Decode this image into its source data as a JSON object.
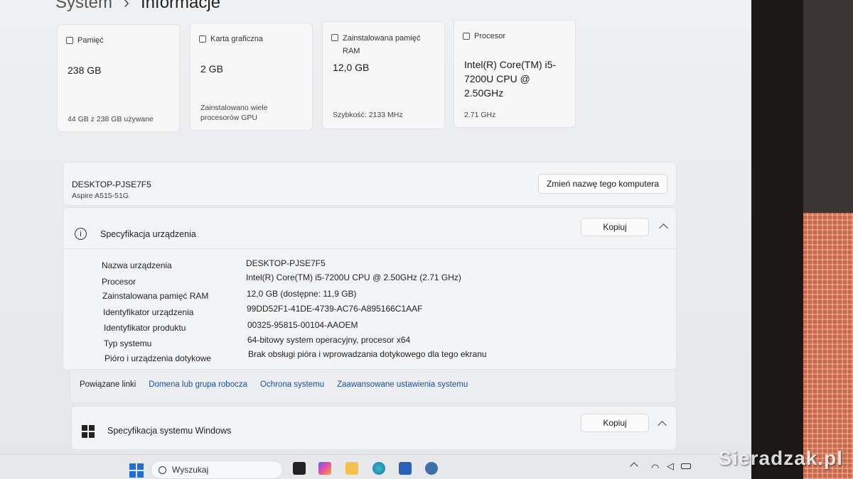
{
  "breadcrumb": {
    "parent": "System",
    "separator": "›",
    "current": "Informacje"
  },
  "cards": [
    {
      "title": "Pamięć",
      "value": "238 GB",
      "detail": "44 GB z 238 GB używane"
    },
    {
      "title": "Karta graficzna",
      "value": "2 GB",
      "detail": "Zainstalowano wiele procesorów GPU"
    },
    {
      "title": "Zainstalowana pamięć RAM",
      "value": "12,0 GB",
      "detail": "Szybkość: 2133 MHz"
    },
    {
      "title": "Procesor",
      "value": "Intel(R) Core(TM) i5-7200U CPU @ 2.50GHz",
      "detail": "2.71 GHz"
    }
  ],
  "computer": {
    "name": "DESKTOP-PJSE7F5",
    "model": "Aspire A515-51G",
    "rename_button": "Zmień nazwę tego komputera"
  },
  "device_spec": {
    "title": "Specyfikacja urządzenia",
    "copy_button": "Kopiuj",
    "rows": [
      {
        "label": "Nazwa urządzenia",
        "value": "DESKTOP-PJSE7F5"
      },
      {
        "label": "Procesor",
        "value": "Intel(R) Core(TM) i5-7200U CPU @ 2.50GHz (2.71 GHz)"
      },
      {
        "label": "Zainstalowana pamięć RAM",
        "value": "12,0 GB (dostępne: 11,9 GB)"
      },
      {
        "label": "Identyfikator urządzenia",
        "value": "99DD52F1-41DE-4739-AC76-A895166C1AAF"
      },
      {
        "label": "Identyfikator produktu",
        "value": "00325-95815-00104-AAOEM"
      },
      {
        "label": "Typ systemu",
        "value": "64-bitowy system operacyjny, procesor x64"
      },
      {
        "label": "Pióro i urządzenia dotykowe",
        "value": "Brak obsługi pióra i wprowadzania dotykowego dla tego ekranu"
      }
    ]
  },
  "related_links": {
    "label": "Powiązane linki",
    "links": [
      "Domena lub grupa robocza",
      "Ochrona systemu",
      "Zaawansowane ustawienia systemu"
    ]
  },
  "windows_spec": {
    "title": "Specyfikacja systemu Windows",
    "copy_button": "Kopiuj"
  },
  "taskbar": {
    "search_placeholder": "Wyszukaj"
  },
  "watermark": "Sieradzak.pl",
  "colors": {
    "link": "#1a4fa0",
    "screen_bg": "#eef0f2",
    "card_bg": "#f7f7f8"
  }
}
